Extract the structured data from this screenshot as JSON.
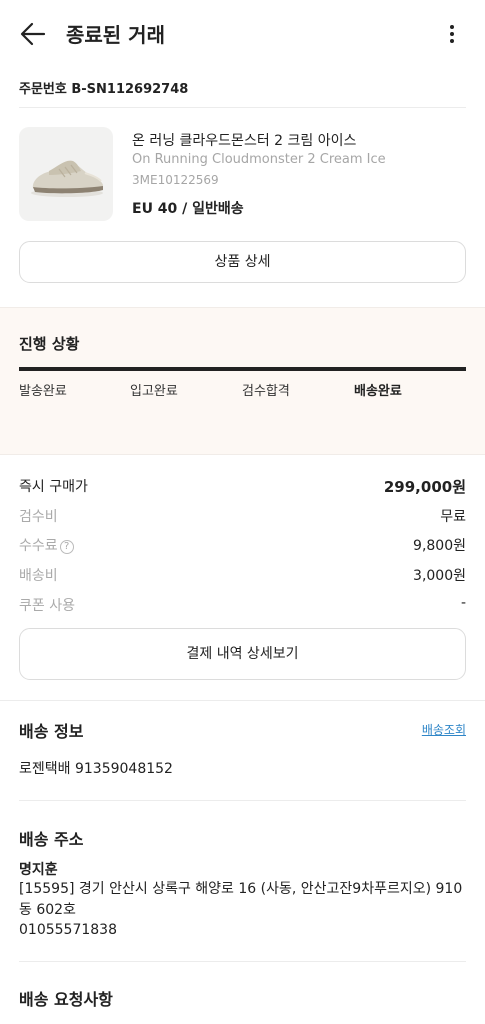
{
  "header": {
    "title": "종료된 거래"
  },
  "order": {
    "number_label": "주문번호 B-SN112692748"
  },
  "product": {
    "name_ko": "온 러닝 클라우드몬스터 2 크림 아이스",
    "name_en": "On Running Cloudmonster 2 Cream Ice",
    "code": "3ME10122569",
    "option": "EU 40 / 일반배송",
    "detail_button": "상품 상세"
  },
  "progress": {
    "title": "진행 상황",
    "steps": [
      "발송완료",
      "입고완료",
      "검수합격",
      "배송완료"
    ],
    "active_step": "배송완료",
    "completion": 1.0
  },
  "payment": {
    "rows": [
      {
        "label": "즉시 구매가",
        "value": "299,000원"
      },
      {
        "label": "검수비",
        "value": "무료"
      },
      {
        "label": "수수료",
        "value": "9,800원"
      },
      {
        "label": "배송비",
        "value": "3,000원"
      },
      {
        "label": "쿠폰 사용",
        "value": "-"
      }
    ],
    "help_icon_text": "?",
    "detail_button": "결제 내역 상세보기"
  },
  "shipping_info": {
    "title": "배송 정보",
    "track_link": "배송조회",
    "carrier": "로젠택배 91359048152"
  },
  "shipping_address": {
    "title": "배송 주소",
    "name": "명지훈",
    "address": "[15595] 경기 안산시 상록구 해양로 16 (사동, 안산고잔9차푸르지오) 910동 602호",
    "phone": "01055571838"
  },
  "shipping_request": {
    "title": "배송 요청사항"
  },
  "icons": {
    "back": "arrow-left-icon",
    "more": "more-vertical-icon",
    "help": "question-circle-icon"
  }
}
